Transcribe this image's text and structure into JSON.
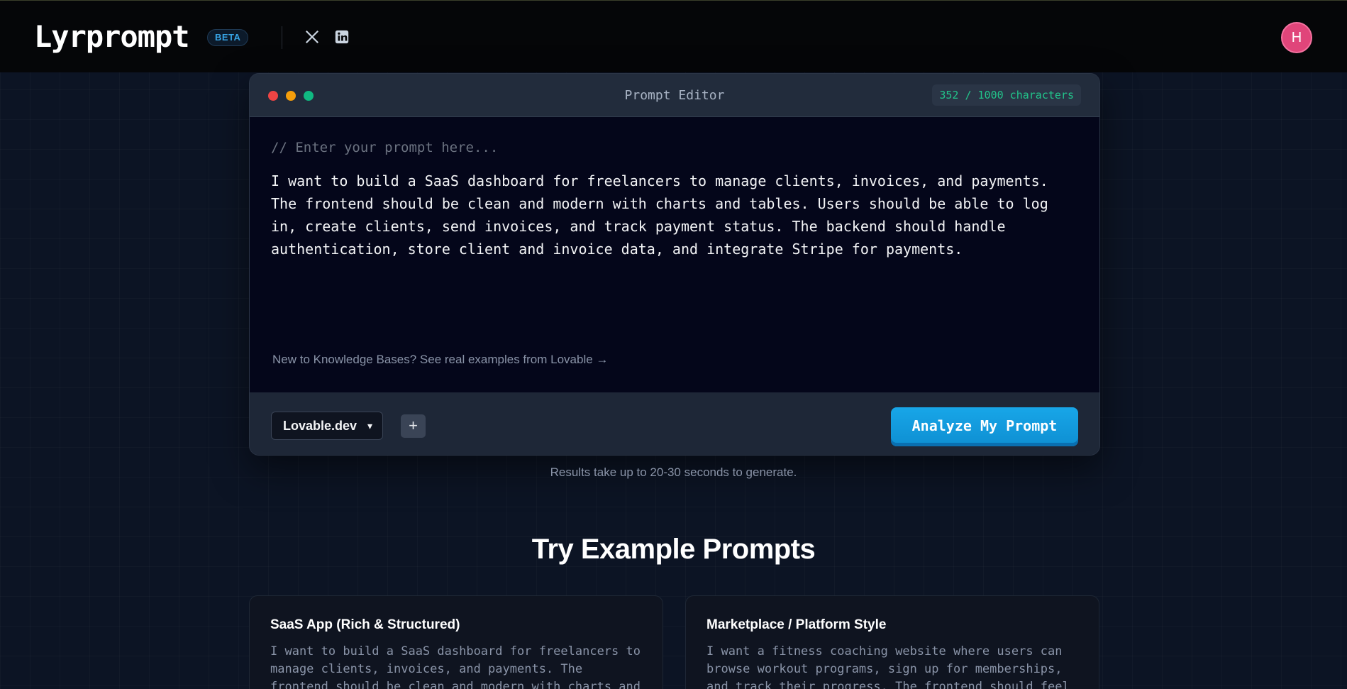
{
  "header": {
    "logo": "Lyrprompt",
    "badge": "BETA",
    "avatar_initial": "H",
    "social_icons": [
      "x-icon",
      "linkedin-icon"
    ]
  },
  "editor": {
    "title": "Prompt Editor",
    "char_count": "352 / 1000 characters",
    "placeholder": "// Enter your prompt here...",
    "text": "I want to build a SaaS dashboard for freelancers to manage clients, invoices, and payments. The frontend should be clean and modern with charts and tables. Users should be able to log in, create clients, send invoices, and track payment status. The backend should handle authentication, store client and invoice data, and integrate Stripe for payments.",
    "kb_link": "New to Knowledge Bases? See real examples from Lovable →",
    "platform": "Lovable.dev",
    "add_label": "+",
    "analyze_label": "Analyze My Prompt"
  },
  "hint": "Results take up to 20-30 seconds to generate.",
  "examples": {
    "title": "Try Example Prompts",
    "cards": [
      {
        "title": "SaaS App (Rich & Structured)",
        "text": "I want to build a SaaS dashboard for freelancers to manage clients, invoices, and payments. The frontend should be clean and modern with charts and"
      },
      {
        "title": "Marketplace / Platform Style",
        "text": "I want a fitness coaching website where users can browse workout programs, sign up for memberships, and track their progress. The frontend should feel"
      }
    ]
  },
  "colors": {
    "accent": "#18a6e8",
    "char_count": "#22c58b",
    "avatar": "#e0457a"
  }
}
